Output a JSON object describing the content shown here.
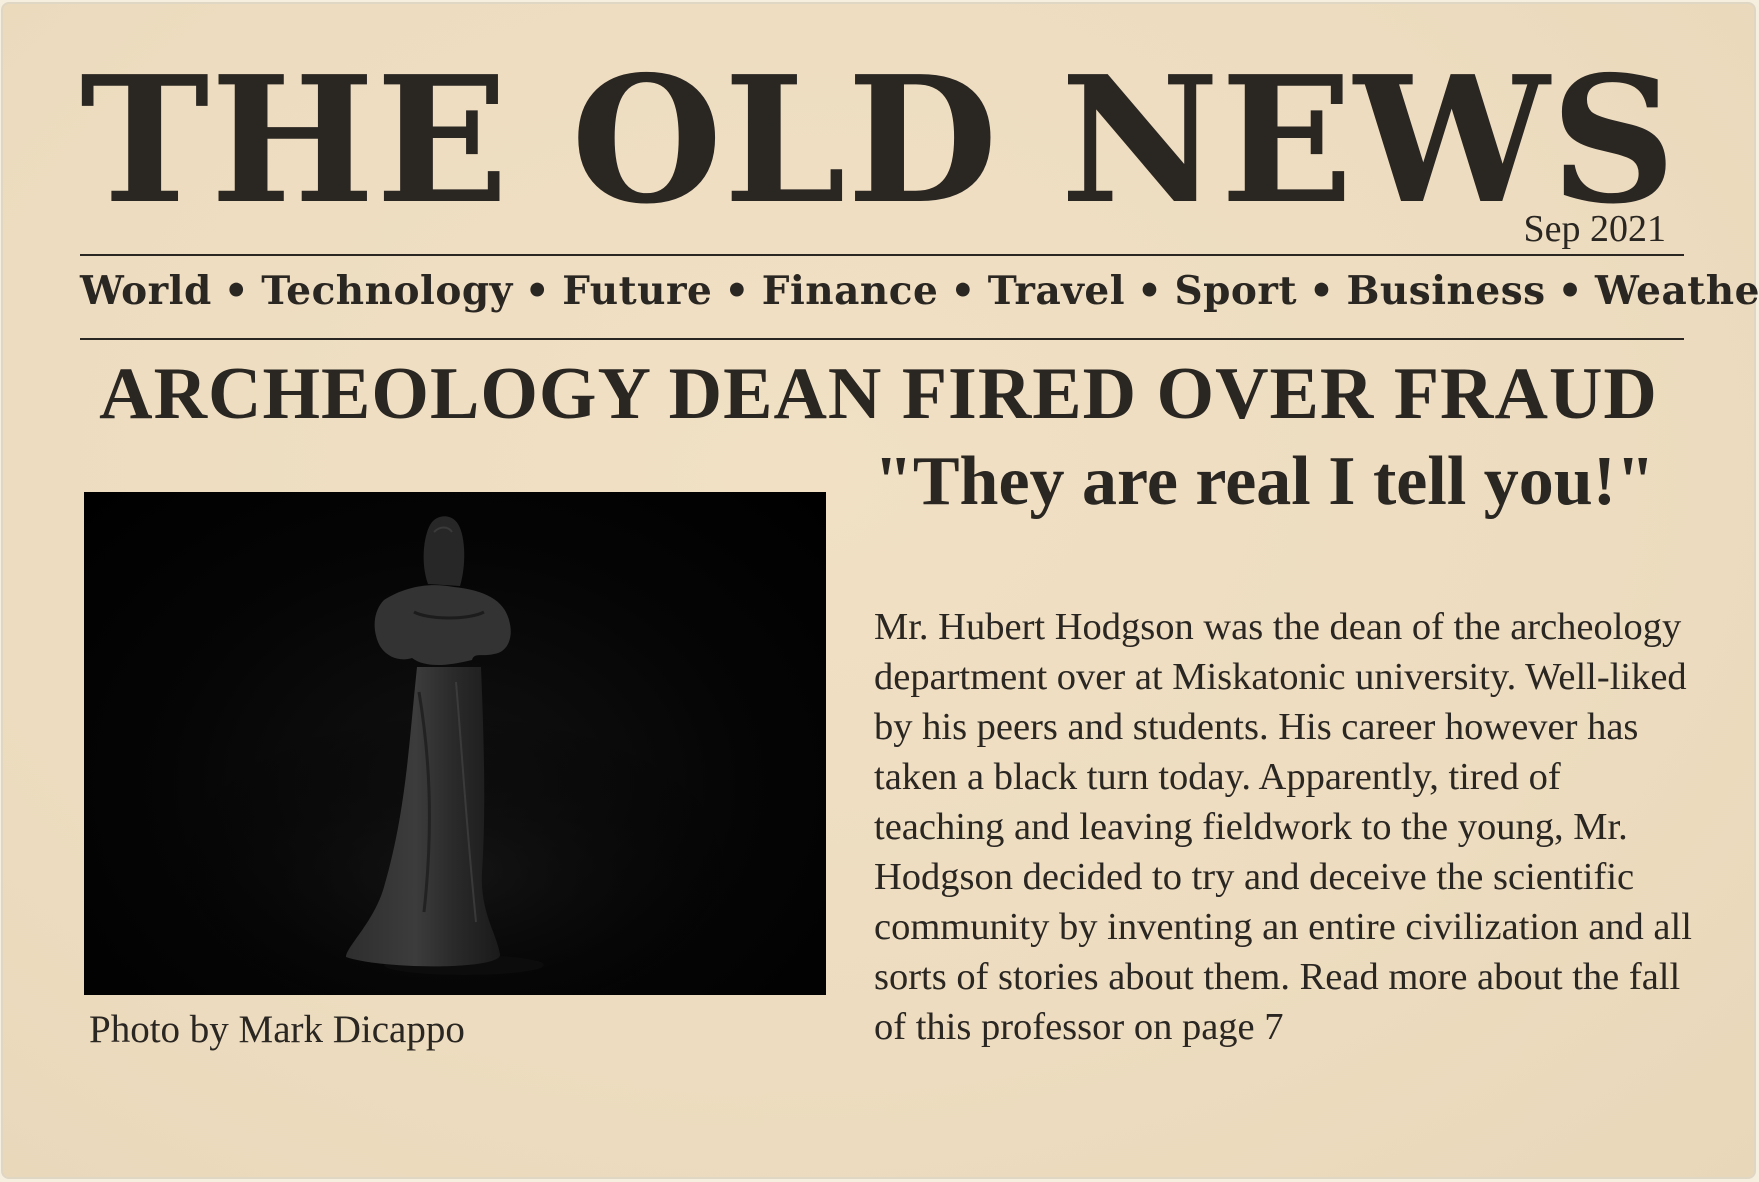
{
  "masthead": {
    "title": "THE OLD NEWS",
    "date": "Sep 2021"
  },
  "nav": {
    "items": [
      "World",
      "Technology",
      "Future",
      "Finance",
      "Travel",
      "Sport",
      "Business",
      "Weather"
    ],
    "separator": "•"
  },
  "article": {
    "headline": "ARCHEOLOGY DEAN FIRED OVER FRAUD",
    "subhead": "\"They are real I tell you!\"",
    "body": "Mr. Hubert Hodgson was the dean of the archeology department over at Miskatonic university. Well-liked by his peers and students. His career however has taken a black turn today. Apparently, tired of teaching and leaving fieldwork to the young, Mr. Hodgson decided to try and deceive the scientific community by inventing an entire civilization and all sorts of stories about them. Read more about the fall of this professor on page 7",
    "photo_caption": "Photo by Mark Dicappo"
  },
  "colors": {
    "paper": "#eddcbf",
    "ink": "#2a2622",
    "photo_bg": "#000000"
  }
}
